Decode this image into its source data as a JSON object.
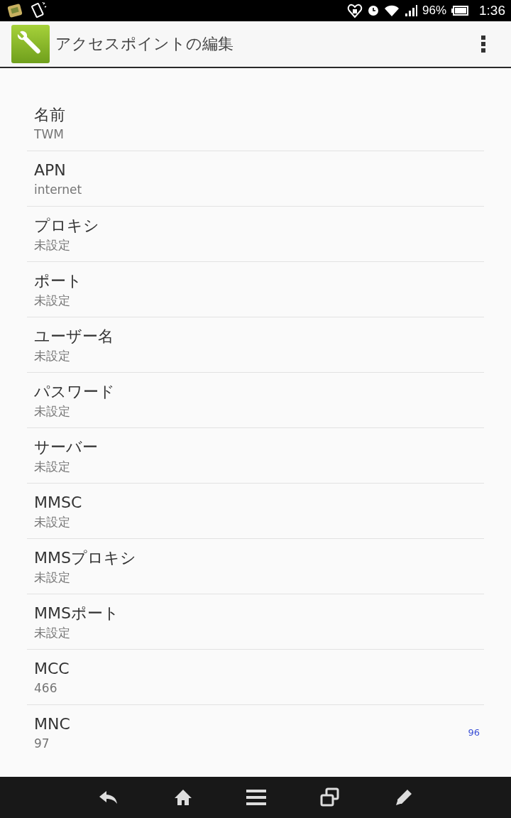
{
  "status_bar": {
    "battery": "96%",
    "time": "1:36"
  },
  "header": {
    "title": "アクセスポイントの編集"
  },
  "settings": [
    {
      "label": "名前",
      "value": "TWM"
    },
    {
      "label": "APN",
      "value": "internet"
    },
    {
      "label": "プロキシ",
      "value": "未設定"
    },
    {
      "label": "ポート",
      "value": "未設定"
    },
    {
      "label": "ユーザー名",
      "value": "未設定"
    },
    {
      "label": "パスワード",
      "value": "未設定"
    },
    {
      "label": "サーバー",
      "value": "未設定"
    },
    {
      "label": "MMSC",
      "value": "未設定"
    },
    {
      "label": "MMSプロキシ",
      "value": "未設定"
    },
    {
      "label": "MMSポート",
      "value": "未設定"
    },
    {
      "label": "MCC",
      "value": "466"
    },
    {
      "label": "MNC",
      "value": "97",
      "side_note": "96"
    }
  ]
}
